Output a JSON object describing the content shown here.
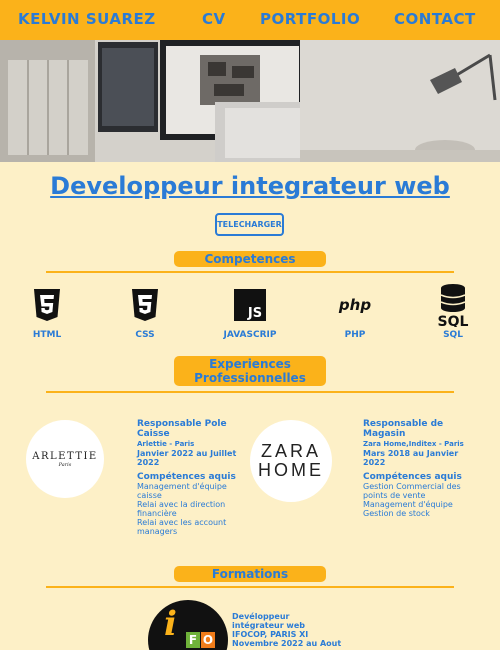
{
  "nav": {
    "brand": "KELVIN SUAREZ",
    "items": [
      "CV",
      "PORTFOLIO",
      "CONTACT"
    ]
  },
  "hero": {
    "image": "desk-workspace-photo"
  },
  "page_title": "Developpeur integrateur web",
  "download_label": "TELECHARGER",
  "sections": {
    "skills": "Competences",
    "experience": "Experiences Professionnelles",
    "education": "Formations"
  },
  "skills": [
    {
      "label": "HTML",
      "icon": "html5-icon"
    },
    {
      "label": "CSS",
      "icon": "css3-icon"
    },
    {
      "label": "JAVASCRIP",
      "icon": "js-icon"
    },
    {
      "label": "PHP",
      "icon": "php-icon"
    },
    {
      "label": "SQL",
      "icon": "sql-icon"
    }
  ],
  "experiences": [
    {
      "logo_lines": [
        "ARLETTIE",
        "Paris"
      ],
      "role": "Responsable Pole Caisse",
      "company": "Arlettie - Paris",
      "dates": "Janvier 2022 au Juillet 2022",
      "skills_title": "Compétences aquis",
      "skills": [
        "Management d'équipe caisse",
        "Relai avec la direction financière",
        "Relai avec les account managers"
      ]
    },
    {
      "logo_lines": [
        "ZARA",
        "HOME"
      ],
      "role": "Responsable de Magasin",
      "company": "Zara Home,Inditex - Paris",
      "dates": "Mars 2018 au Janvier 2022",
      "skills_title": "Compétences aquis",
      "skills": [
        "Gestion Commercial des points de vente",
        "Management d'équipe",
        "Gestion de stock"
      ]
    }
  ],
  "education": {
    "logo_letters": [
      "i",
      "F",
      "O"
    ],
    "title": "Devéloppeur intégrateur web",
    "school": "IFOCOP, PARIS XI",
    "dates": "Novembre 2022 au Aout"
  },
  "colors": {
    "accent": "#fbb21a",
    "text": "#2a7bd6",
    "background": "#fdf0c7"
  }
}
